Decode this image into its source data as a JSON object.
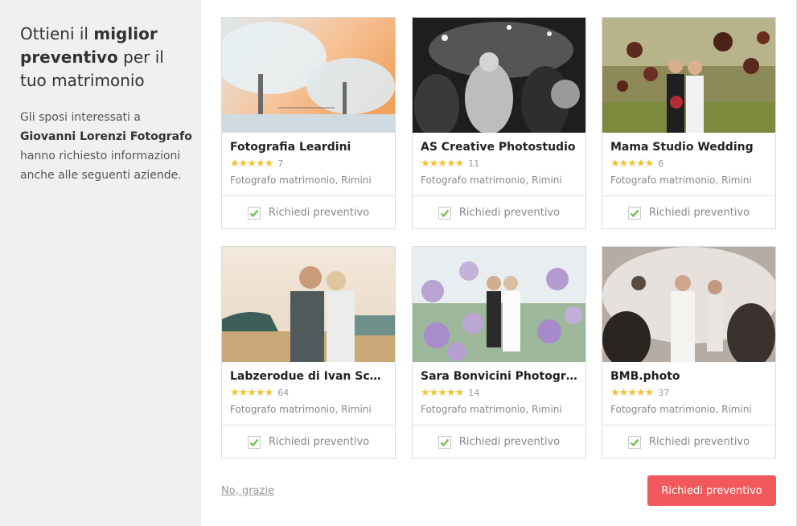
{
  "sidebar": {
    "title_part1": "Ottieni il ",
    "title_bold": "miglior preventivo",
    "title_part2": " per il tuo matrimonio",
    "desc_part1": "Gli sposi interessati a ",
    "desc_bold": "Giovanni Lorenzi Fotografo",
    "desc_part2": " hanno richiesto informazioni anche alle seguenti aziende."
  },
  "cards": [
    {
      "name": "Fotografia Leardini",
      "stars": "★★★★★",
      "reviews": "7",
      "category": "Fotografo matrimonio, Rimini",
      "cta": "Richiedi preventivo",
      "checked": true
    },
    {
      "name": "AS Creative Photostudio",
      "stars": "★★★★★",
      "reviews": "11",
      "category": "Fotografo matrimonio, Rimini",
      "cta": "Richiedi preventivo",
      "checked": true
    },
    {
      "name": "Mama Studio Wedding",
      "stars": "★★★★★",
      "reviews": "6",
      "category": "Fotografo matrimonio, Rimini",
      "cta": "Richiedi preventivo",
      "checked": true
    },
    {
      "name": "Labzerodue di Ivan Scog...",
      "stars": "★★★★★",
      "reviews": "64",
      "category": "Fotografo matrimonio, Rimini",
      "cta": "Richiedi preventivo",
      "checked": true
    },
    {
      "name": "Sara Bonvicini Photogra...",
      "stars": "★★★★★",
      "reviews": "14",
      "category": "Fotografo matrimonio, Rimini",
      "cta": "Richiedi preventivo",
      "checked": true
    },
    {
      "name": "BMB.photo",
      "stars": "★★★★★",
      "reviews": "37",
      "category": "Fotografo matrimonio, Rimini",
      "cta": "Richiedi preventivo",
      "checked": true
    }
  ],
  "footer": {
    "no_thanks": "No, grazie",
    "submit": "Richiedi preventivo"
  },
  "colors": {
    "accent": "#f1595c",
    "star": "#f3c22e",
    "check": "#6cbd45",
    "sidebar_bg": "#f0f0f0"
  }
}
